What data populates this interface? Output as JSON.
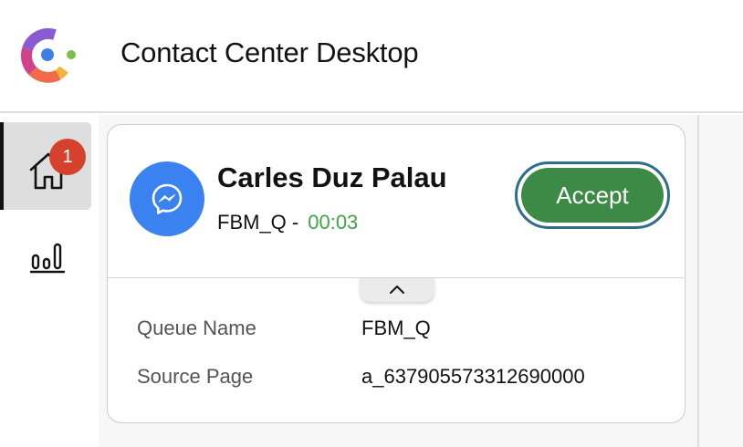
{
  "app": {
    "title": "Contact Center Desktop",
    "logo_icon": "webex-contact-center-logo"
  },
  "nav": {
    "items": [
      {
        "name": "home",
        "icon": "home-icon",
        "badge": "1",
        "active": true
      },
      {
        "name": "statistics",
        "icon": "bar-chart-icon",
        "active": false
      }
    ]
  },
  "task_card": {
    "channel_icon": "facebook-messenger-icon",
    "customer_name": "Carles Duz Palau",
    "queue": "FBM_Q -",
    "timer": "00:03",
    "accept_label": "Accept",
    "collapse_icon": "chevron-up-icon",
    "details": [
      {
        "label": "Queue Name",
        "value": "FBM_Q"
      },
      {
        "label": "Source Page",
        "value": "a_637905573312690000"
      }
    ]
  },
  "colors": {
    "accent_green": "#3d8a47",
    "timer_green": "#3ea547",
    "focus_ring": "#2d6e8c",
    "badge_red": "#d4412d",
    "messenger_blue": "#3a82f0"
  }
}
